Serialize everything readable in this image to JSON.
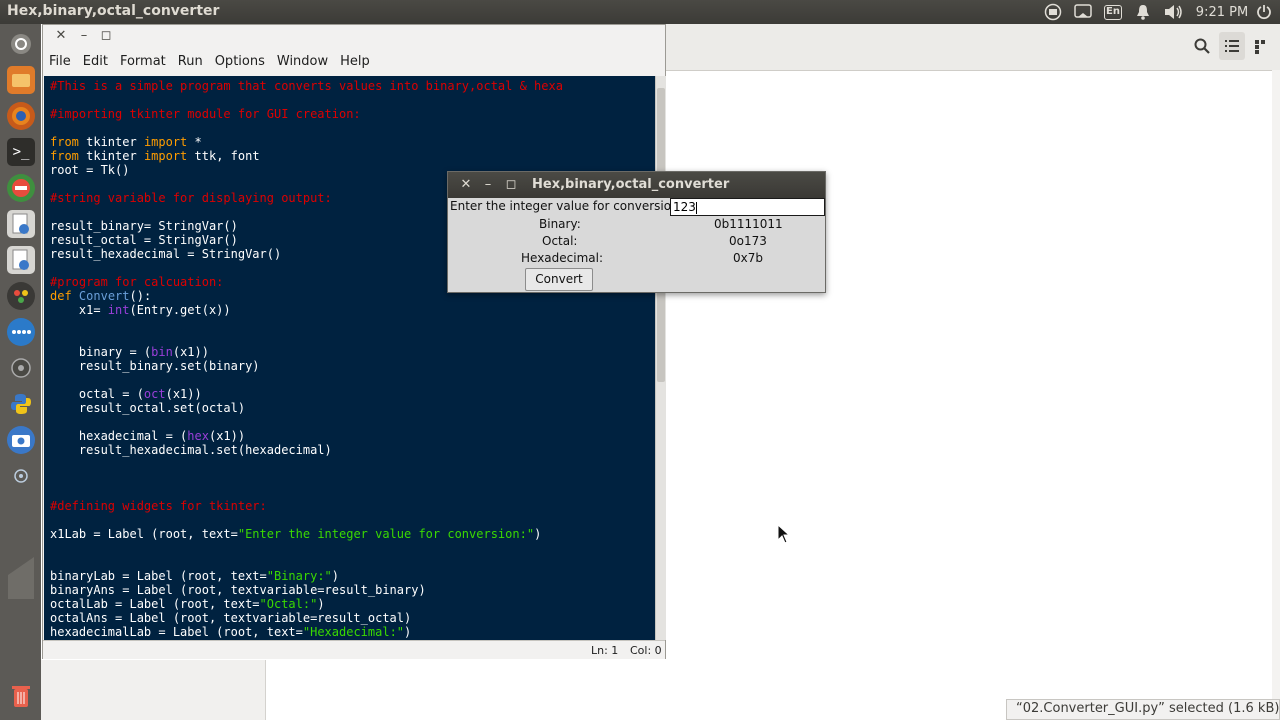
{
  "topbar": {
    "window_title": "Hex,binary,octal_converter",
    "keyboard_layout": "En",
    "clock": "9:21 PM"
  },
  "launcher": {
    "items": [
      "dash-icon",
      "files-icon",
      "firefox-icon",
      "terminal-icon",
      "settings-icon",
      "text-editor-icon",
      "text-editor-icon-2",
      "app-icon",
      "chat-icon",
      "disk-icon",
      "python-icon",
      "camera-icon",
      "network-icon",
      "workspace-icon",
      "trash-icon"
    ]
  },
  "editor": {
    "menu": [
      "File",
      "Edit",
      "Format",
      "Run",
      "Options",
      "Window",
      "Help"
    ],
    "code_lines": [
      [
        [
          "cm",
          "#This is a simple program that converts values into binary,octal & hexa"
        ]
      ],
      [],
      [
        [
          "cm",
          "#importing tkinter module for GUI creation:"
        ]
      ],
      [],
      [
        [
          "kw",
          "from"
        ],
        [
          "tx",
          " tkinter "
        ],
        [
          "kw",
          "import"
        ],
        [
          "tx",
          " *"
        ]
      ],
      [
        [
          "kw",
          "from"
        ],
        [
          "tx",
          " tkinter "
        ],
        [
          "kw",
          "import"
        ],
        [
          "tx",
          " ttk, font"
        ]
      ],
      [
        [
          "tx",
          "root = Tk()"
        ]
      ],
      [],
      [
        [
          "cm",
          "#string variable for displaying output:"
        ]
      ],
      [],
      [
        [
          "tx",
          "result_binary= StringVar()"
        ]
      ],
      [
        [
          "tx",
          "result_octal = StringVar()"
        ]
      ],
      [
        [
          "tx",
          "result_hexadecimal = StringVar()"
        ]
      ],
      [],
      [
        [
          "cm",
          "#program for calcuation:"
        ]
      ],
      [
        [
          "kw",
          "def"
        ],
        [
          "tx",
          " "
        ],
        [
          "fn",
          "Convert"
        ],
        [
          "tx",
          "():"
        ]
      ],
      [
        [
          "tx",
          "    x1= "
        ],
        [
          "bi",
          "int"
        ],
        [
          "tx",
          "(Entry.get(x))"
        ]
      ],
      [],
      [],
      [
        [
          "tx",
          "    binary = ("
        ],
        [
          "bi",
          "bin"
        ],
        [
          "tx",
          "(x1))"
        ]
      ],
      [
        [
          "tx",
          "    result_binary.set(binary)"
        ]
      ],
      [],
      [
        [
          "tx",
          "    octal = ("
        ],
        [
          "bi",
          "oct"
        ],
        [
          "tx",
          "(x1))"
        ]
      ],
      [
        [
          "tx",
          "    result_octal.set(octal)"
        ]
      ],
      [],
      [
        [
          "tx",
          "    hexadecimal = ("
        ],
        [
          "bi",
          "hex"
        ],
        [
          "tx",
          "(x1))"
        ]
      ],
      [
        [
          "tx",
          "    result_hexadecimal.set(hexadecimal)"
        ]
      ],
      [],
      [],
      [],
      [
        [
          "cm",
          "#defining widgets for tkinter:"
        ]
      ],
      [],
      [
        [
          "tx",
          "x1Lab = Label (root, text="
        ],
        [
          "st",
          "\"Enter the integer value for conversion:\""
        ],
        [
          "tx",
          ")"
        ]
      ],
      [],
      [],
      [
        [
          "tx",
          "binaryLab = Label (root, text="
        ],
        [
          "st",
          "\"Binary:\""
        ],
        [
          "tx",
          ")"
        ]
      ],
      [
        [
          "tx",
          "binaryAns = Label (root, textvariable=result_binary)"
        ]
      ],
      [
        [
          "tx",
          "octalLab = Label (root, text="
        ],
        [
          "st",
          "\"Octal:\""
        ],
        [
          "tx",
          ")"
        ]
      ],
      [
        [
          "tx",
          "octalAns = Label (root, textvariable=result_octal)"
        ]
      ],
      [
        [
          "tx",
          "hexadecimalLab = Label (root, text="
        ],
        [
          "st",
          "\"Hexadecimal:\""
        ],
        [
          "tx",
          ")"
        ]
      ]
    ],
    "status_line": "Ln: 1",
    "status_col": "Col: 0"
  },
  "dialog": {
    "title": "Hex,binary,octal_converter",
    "prompt": "Enter the integer value for conversion:",
    "entry_value": "123",
    "binary_label": "Binary:",
    "binary_value": "0b1111011",
    "octal_label": "Octal:",
    "octal_value": "0o173",
    "hex_label": "Hexadecimal:",
    "hex_value": "0x7b",
    "convert_button": "Convert"
  },
  "file_manager": {
    "status": "“02.Converter_GUI.py” selected (1.6 kB)"
  },
  "colors": {
    "editor_bg": "#002240",
    "comment": "#dd0000",
    "keyword": "#ff9d00",
    "builtin": "#9a3fd9",
    "function": "#6a9fd9",
    "string": "#3ad900"
  }
}
